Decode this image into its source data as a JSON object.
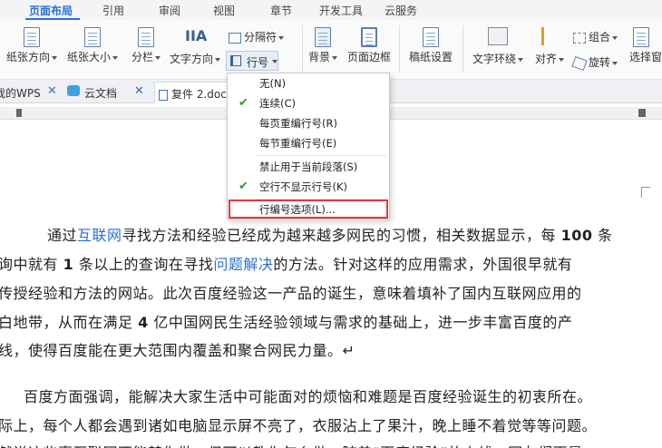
{
  "menu": {
    "tabs": [
      {
        "label": "页面布局",
        "active": true
      },
      {
        "label": "引用"
      },
      {
        "label": "审阅"
      },
      {
        "label": "视图"
      },
      {
        "label": "章节"
      },
      {
        "label": "开发工具"
      },
      {
        "label": "云服务"
      }
    ]
  },
  "ribbon": {
    "paper_direction": "纸张方向",
    "paper_size": "纸张大小",
    "columns": "分栏",
    "text_direction": "文字方向",
    "separator": "分隔符",
    "line_number": "行号",
    "background": "背景",
    "page_border": "页面边框",
    "manuscript": "稿纸设置",
    "text_wrap": "文字环绕",
    "align": "对齐",
    "group": "组合",
    "rotate": "旋转",
    "select_pane": "选择窗"
  },
  "doc_tabs": [
    {
      "label": "我的WPS"
    },
    {
      "label": "云文档"
    },
    {
      "label": "复件 2.doc",
      "active": true
    }
  ],
  "dropdown": {
    "items": [
      {
        "label": "无(N)",
        "checked": false
      },
      {
        "label": "连续(C)",
        "checked": true
      },
      {
        "label": "每页重编行号(R)",
        "checked": false
      },
      {
        "label": "每节重编行号(E)",
        "checked": false
      },
      {
        "label": "禁止用于当前段落(S)",
        "checked": false
      },
      {
        "label": "空行不显示行号(K)",
        "checked": true
      },
      {
        "label": "行编号选项(L)...",
        "checked": false,
        "highlighted": true
      }
    ]
  },
  "document": {
    "p1": {
      "l1_a": "通过",
      "l1_link": "互联网",
      "l1_b": "寻找方法和经验已经成为越来越多网民的习惯，相关数据显示，每",
      "l1_num": "100",
      "l1_c": "条",
      "l2_a": "询中就有",
      "l2_num": "1",
      "l2_b": "条以上的查询在寻找",
      "l2_link": "问题解决",
      "l2_c": "的方法。针对这样的应用需求，外国很早就有",
      "l3": "传授经验和方法的网站。此次百度经验这一产品的诞生，意味着填补了国内互联网应用的",
      "l4_a": "白地带，从而在满足",
      "l4_num": "4",
      "l4_b": "亿中国网民生活经验领域与需求的基础上，进一步丰富百度的产",
      "l5": "线，使得百度能在更大范围内覆盖和聚合网民力量。↵"
    },
    "p2": {
      "l1": "百度方面强调，能解决大家生活中可能面对的烦恼和难题是百度经验诞生的初衷所在。",
      "l2": "际上，每个人都会遇到诸如电脑显示屏不亮了，衣服沾上了果汁，晚上睡不着觉等等问题。",
      "l3": "然说这些事互联网不能替你做，但可以教你怎么做。随着“百度经验”的上线，网友们更是"
    }
  },
  "colors": {
    "accent": "#2b6fd4",
    "highlight_border": "#e23b3b",
    "check": "#2a9a3a"
  }
}
